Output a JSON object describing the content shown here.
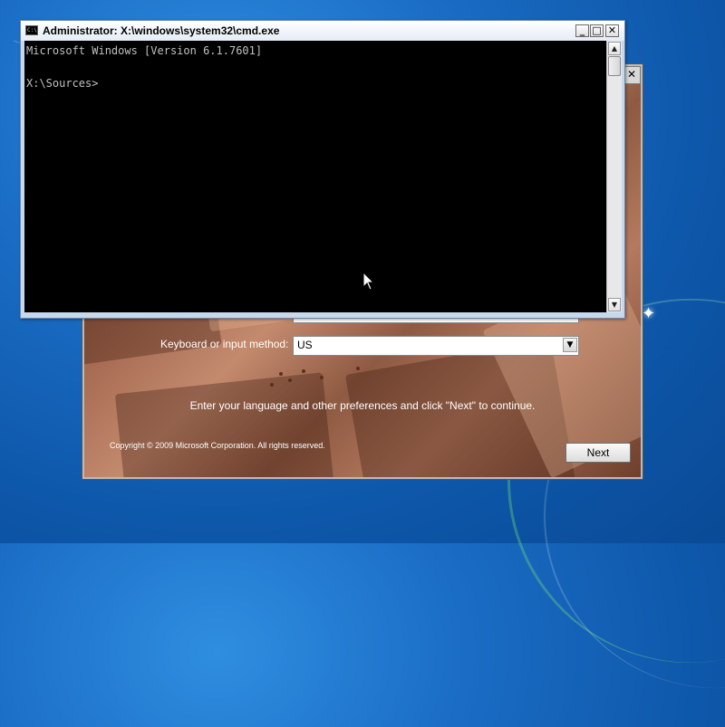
{
  "cmd": {
    "title": "Administrator: X:\\windows\\system32\\cmd.exe",
    "icon_text": "C:\\",
    "minimize": "_",
    "maximize": "□",
    "close": "✕",
    "console_lines": [
      "Microsoft Windows [Version 6.1.7601]",
      "",
      "X:\\Sources>"
    ],
    "scroll_up": "▲",
    "scroll_down": "▼"
  },
  "setup": {
    "close": "✕",
    "keyboard_label": "Keyboard or input method:",
    "keyboard_value": "US",
    "dropdown_arrow": "▼",
    "instruction": "Enter your language and other preferences and click \"Next\" to continue.",
    "copyright": "Copyright © 2009 Microsoft Corporation. All rights reserved.",
    "next_label": "Next"
  },
  "icons": {
    "cmd": "cmd-icon",
    "cursor": "mouse-pointer-icon",
    "sparkle": "sparkle-icon"
  }
}
